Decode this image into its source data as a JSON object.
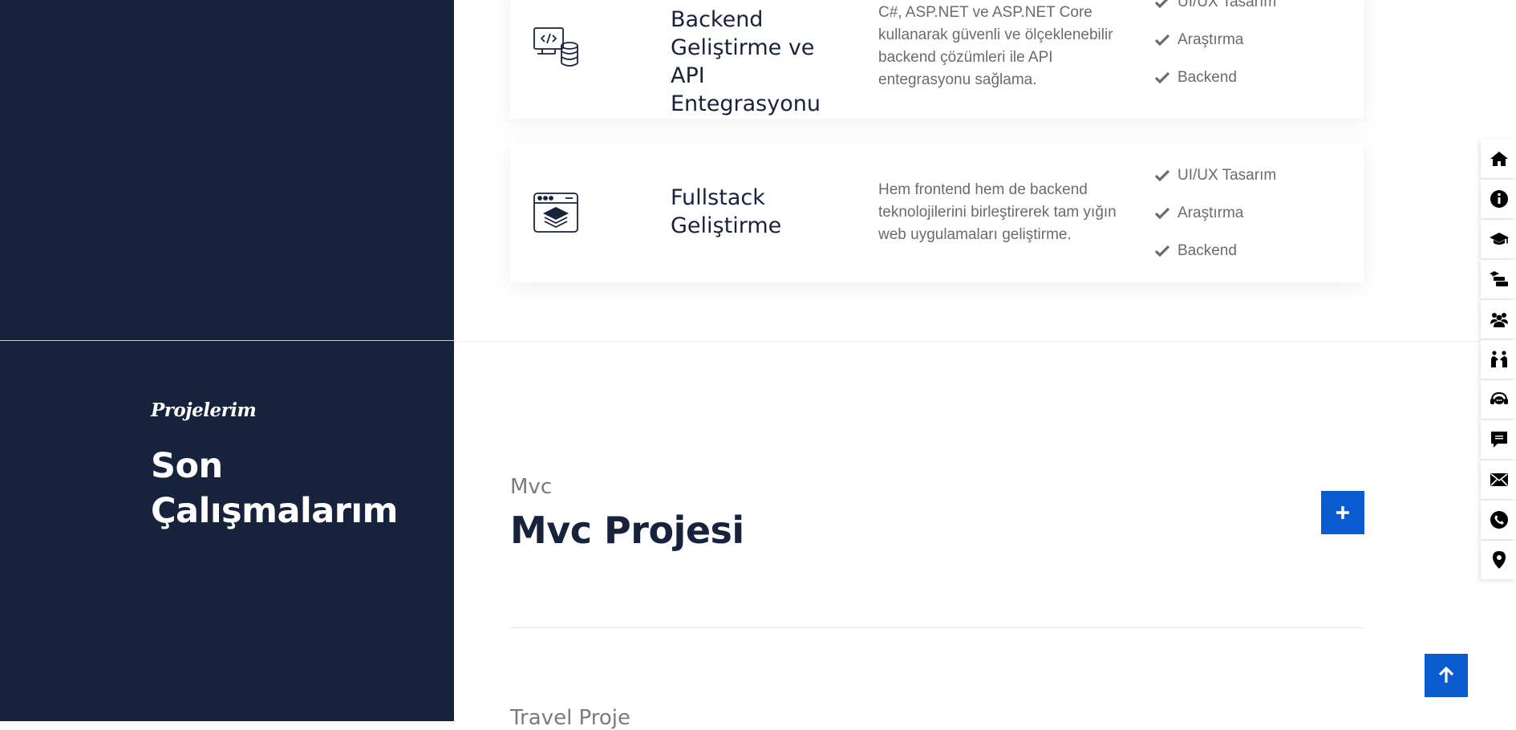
{
  "services": [
    {
      "title": "Backend Geliştirme ve API Entegrasyonu",
      "description": "C#, ASP.NET ve ASP.NET Core kullanarak güvenli ve ölçeklenebilir backend çözümleri ile API entegrasyonu sağlama.",
      "icon": "server-database-icon",
      "features": [
        "UI/UX Tasarım",
        "Araştırma",
        "Backend"
      ]
    },
    {
      "title": "Fullstack Geliştirme",
      "description": "Hem frontend hem de backend teknolojilerini birleştirerek tam yığın web uygulamaları geliştirme.",
      "icon": "browser-layers-icon",
      "features": [
        "UI/UX Tasarım",
        "Araştırma",
        "Backend"
      ]
    }
  ],
  "projects_section": {
    "eyebrow": "Projelerim",
    "title": "Son Çalışmalarım"
  },
  "projects": [
    {
      "category": "Mvc",
      "title": "Mvc Projesi"
    },
    {
      "category": "Travel Proje"
    }
  ],
  "side_nav": [
    "home-icon",
    "info-icon",
    "graduation-cap-icon",
    "experience-icon",
    "team-icon",
    "handshake-icon",
    "support-icon",
    "portfolio-icon",
    "mail-icon",
    "phone-icon",
    "location-icon"
  ],
  "colors": {
    "dark_navy": "#17223d",
    "accent_blue": "#0a5bd0",
    "text_gray": "#6b6b6b"
  }
}
